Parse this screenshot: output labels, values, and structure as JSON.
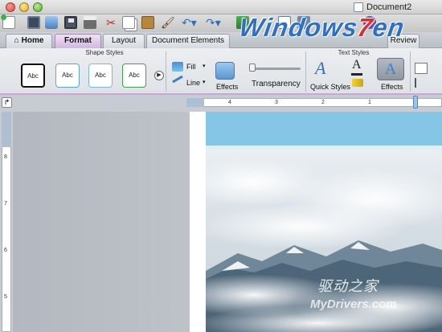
{
  "window": {
    "title": "Document2"
  },
  "ribbon_tabs": [
    "Home",
    "Format",
    "Layout",
    "Document Elements",
    "Review"
  ],
  "active_tab": "Format",
  "ribbon": {
    "shape_styles_label": "Shape Styles",
    "text_styles_label": "Text Styles",
    "style_swatches": [
      "Abc",
      "Abc",
      "Abc",
      "Abc"
    ],
    "fill_label": "Fill",
    "line_label": "Line",
    "shape_effects_label": "Effects",
    "transparency_label": "Transparency",
    "transparency_value": 0,
    "quick_styles_label": "Quick Styles",
    "text_effects_label": "Effects"
  },
  "ruler": {
    "h_numbers": [
      "4",
      "3",
      "2",
      "1"
    ],
    "v_numbers": [
      "8",
      "7",
      "6",
      "5"
    ]
  },
  "watermark": {
    "brand_a": "Windows",
    "brand_b": "7",
    "brand_c": "en",
    "cn_text": "驱动之家",
    "url": "MyDrivers.com"
  },
  "colors": {
    "format_tab": "#d2b7e0",
    "banner": "#85c6e7",
    "accent": "#2f6fc8"
  },
  "icons": [
    "new-doc-icon",
    "gallery-icon",
    "open-icon",
    "save-icon",
    "print-icon",
    "cut-icon",
    "copy-icon",
    "paste-icon",
    "format-painter-icon",
    "undo-icon",
    "redo-icon"
  ]
}
